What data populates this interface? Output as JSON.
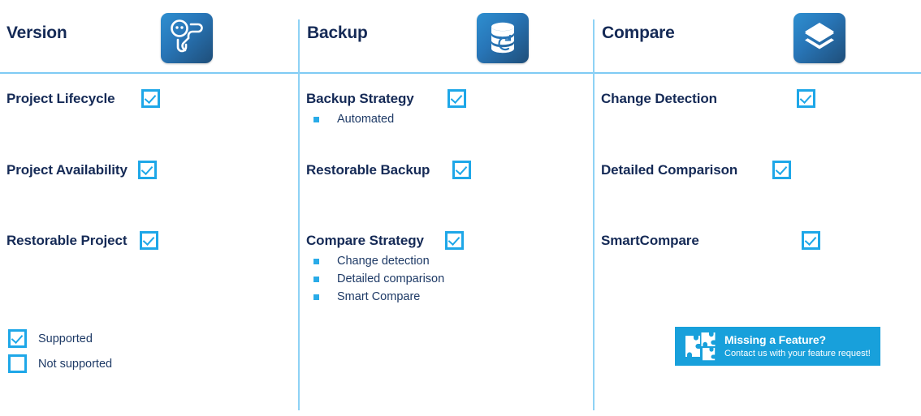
{
  "theme": {
    "title_color": "#152A56",
    "accent_blue": "#1EA7E8",
    "rule_blue": "#8ED2F5",
    "banner_blue": "#18A0DB",
    "icon_gradient_from": "#2E8FD0",
    "icon_gradient_to": "#1F4E79"
  },
  "columns": [
    {
      "title": "Version",
      "icon": "version-tree-icon",
      "features": [
        {
          "label": "Project Lifecycle",
          "supported": true,
          "sub": []
        },
        {
          "label": "Project Availability",
          "supported": true,
          "sub": []
        },
        {
          "label": "Restorable Project",
          "supported": true,
          "sub": []
        }
      ]
    },
    {
      "title": "Backup",
      "icon": "database-restore-icon",
      "features": [
        {
          "label": "Backup Strategy",
          "supported": true,
          "sub": [
            "Automated"
          ]
        },
        {
          "label": "Restorable Backup",
          "supported": true,
          "sub": []
        },
        {
          "label": "Compare Strategy",
          "supported": true,
          "sub": [
            "Change detection",
            "Detailed comparison",
            "Smart Compare"
          ]
        }
      ]
    },
    {
      "title": "Compare",
      "icon": "layers-icon",
      "features": [
        {
          "label": "Change Detection",
          "supported": true,
          "sub": []
        },
        {
          "label": "Detailed Comparison",
          "supported": true,
          "sub": []
        },
        {
          "label": "SmartCompare",
          "supported": true,
          "sub": []
        }
      ]
    }
  ],
  "legend": [
    {
      "label": "Supported",
      "checked": true
    },
    {
      "label": "Not supported",
      "checked": false
    }
  ],
  "banner": {
    "title": "Missing a Feature?",
    "subtitle": "Contact us with your feature request!",
    "icon": "puzzle-pieces-icon"
  }
}
